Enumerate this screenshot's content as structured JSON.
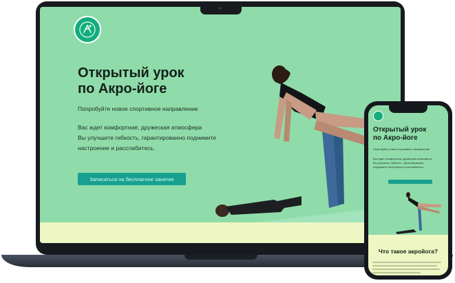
{
  "laptop": {
    "hero": {
      "title_line1": "Открытый урок",
      "title_line2": "по Акро-йоге",
      "subtitle": "Попробуйте новое спортивное направление",
      "body_line1": "Вас ждет комфортная, дружеская атмосфера",
      "body_line2": "Вы улучшите гибкость, гарантированно поднимите",
      "body_line3": "настроение и расслабитесь.",
      "cta_label": "Записаться на бесплатное занятие"
    }
  },
  "phone": {
    "hero": {
      "title_line1": "Открытый урок",
      "title_line2": "по Акро-йоге",
      "subtitle": "Попробуйте новое спортивное направление",
      "body_line1": "Вас ждет комфортная, дружеская атмосфера",
      "body_line2": "Вы улучшите гибкость, гарантированно",
      "body_line3": "поднимите настроение и расслабитесь."
    },
    "section_title": "Что такое акройога?"
  },
  "colors": {
    "background": "#8fdcaa",
    "accent": "#17a08f",
    "logo": "#13ad7c",
    "footer": "#eef7c3"
  },
  "icons": [
    "logo-icon"
  ]
}
